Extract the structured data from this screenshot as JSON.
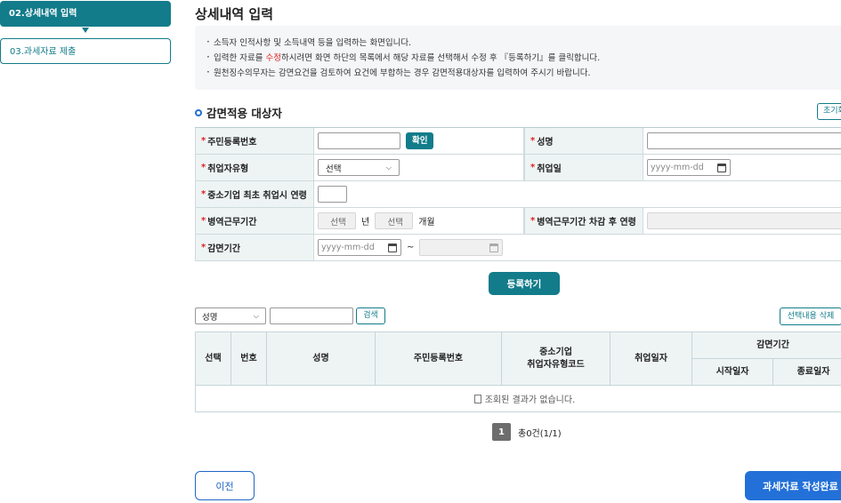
{
  "steps": {
    "current": "02.상세내역 입력",
    "next": "03.과세자료 제출"
  },
  "page_title": "상세내역 입력",
  "notice": {
    "line1": "소득자 인적사항 및 소득내역 등을 입력하는 화면입니다.",
    "line2_pre": "입력한 자료를 ",
    "line2_red": "수정",
    "line2_post": "하시려면 화면 하단의 목록에서 해당 자료를 선택해서 수정 후 『등록하기』를 클릭합니다.",
    "line3": "원천징수의무자는 감면요건을 검토하여 요건에 부합하는 경우 감면적용대상자를 입력하여 주시기 바랍니다."
  },
  "section": {
    "title": "감면적용 대상자",
    "reset_label": "초기화"
  },
  "form": {
    "rrn_label": "주민등록번호",
    "confirm_label": "확인",
    "name_label": "성명",
    "emp_type_label": "취업자유형",
    "emp_type_value": "선택",
    "emp_date_label": "취업일",
    "date_placeholder": "yyyy-mm-dd",
    "first_age_label": "중소기업 최초 취업시 연령",
    "military_label": "병역근무기간",
    "year_select": "선택",
    "year_unit": "년",
    "month_select": "선택",
    "month_unit": "개월",
    "military_age_label": "병역근무기간 차감 후 연령",
    "period_label": "감면기간",
    "tilde": "~"
  },
  "register_label": "등록하기",
  "search": {
    "field": "성명",
    "button": "검색",
    "delete_button": "선택내용 삭제"
  },
  "table": {
    "headers": {
      "select": "선택",
      "no": "번호",
      "name": "성명",
      "rrn": "주민등록번호",
      "sme_line1": "중소기업",
      "sme_line2": "취업자유형코드",
      "emp_date": "취업일자",
      "period": "감면기간",
      "start": "시작일자",
      "end": "종료일자"
    },
    "empty": "조회된 결과가 없습니다."
  },
  "pagination": {
    "page": "1",
    "summary": "총0건(1/1)"
  },
  "footer": {
    "prev": "이전",
    "complete": "과세자료 작성완료"
  },
  "colors": {
    "teal": "#127c8a",
    "blue": "#2270d8",
    "required": "#e02020"
  }
}
